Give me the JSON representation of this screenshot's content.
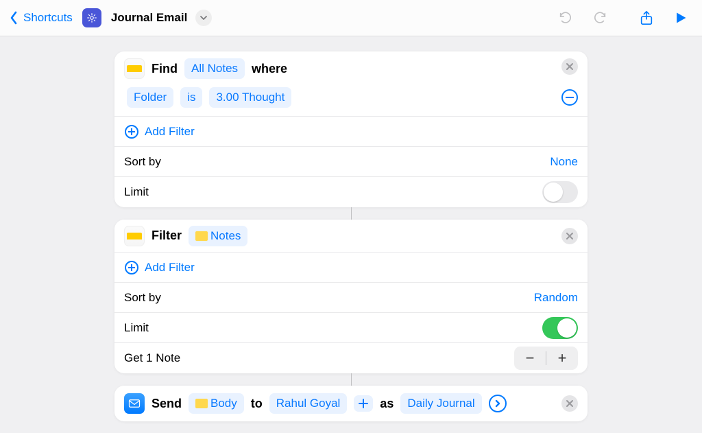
{
  "topbar": {
    "back_label": "Shortcuts",
    "title": "Journal Email"
  },
  "actions": {
    "find": {
      "prefix": "Find",
      "scope_token": "All Notes",
      "suffix": "where",
      "filter": {
        "field": "Folder",
        "op": "is",
        "value": "3.00 Thought"
      },
      "add_filter_label": "Add Filter",
      "sort_label": "Sort by",
      "sort_value": "None",
      "limit_label": "Limit",
      "limit_on": false
    },
    "filter": {
      "prefix": "Filter",
      "source_token": "Notes",
      "add_filter_label": "Add Filter",
      "sort_label": "Sort by",
      "sort_value": "Random",
      "limit_label": "Limit",
      "limit_on": true,
      "get_label": "Get 1 Note"
    },
    "send": {
      "prefix": "Send",
      "body_token": "Body",
      "to_word": "to",
      "recipient_token": "Rahul Goyal",
      "as_word": "as",
      "subject_token": "Daily Journal"
    }
  }
}
